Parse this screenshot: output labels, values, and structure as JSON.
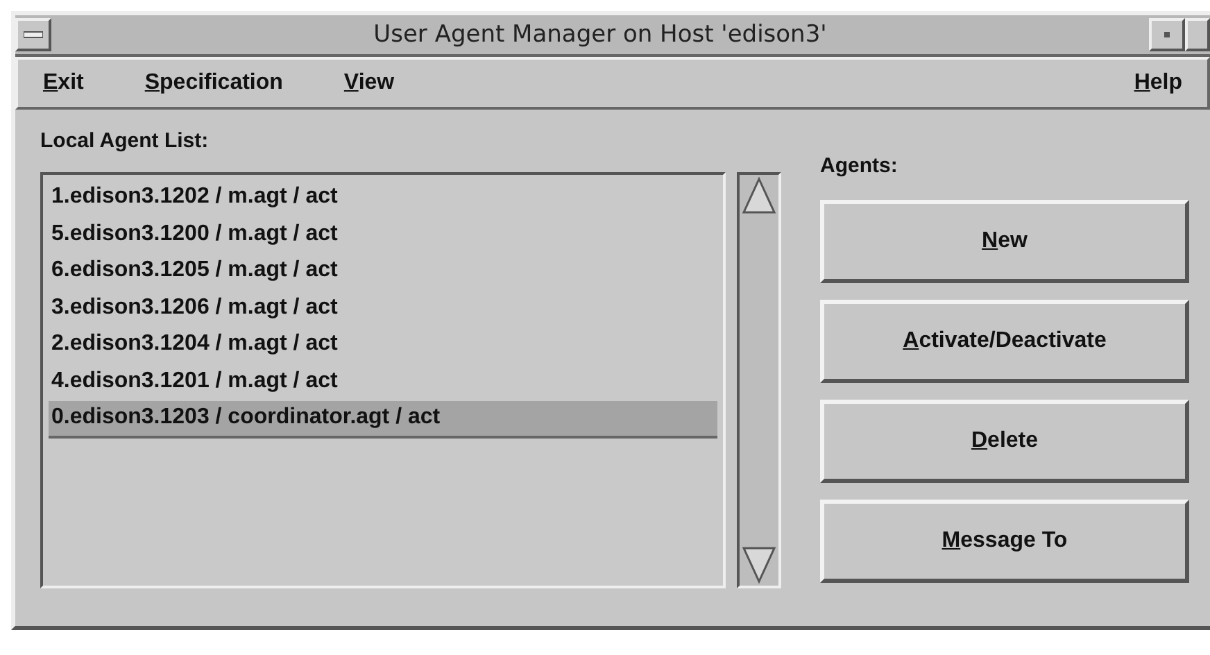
{
  "window": {
    "title": "User Agent Manager on Host 'edison3'"
  },
  "menu": [
    "Exit",
    "Specification",
    "View"
  ],
  "help_menu": "Help",
  "list": {
    "label": "Local Agent List:",
    "items": [
      {
        "text": "1.edison3.1202 / m.agt / act",
        "selected": false
      },
      {
        "text": "5.edison3.1200 / m.agt / act",
        "selected": false
      },
      {
        "text": "6.edison3.1205 / m.agt / act",
        "selected": false
      },
      {
        "text": "3.edison3.1206 / m.agt / act",
        "selected": false
      },
      {
        "text": "2.edison3.1204 / m.agt / act",
        "selected": false
      },
      {
        "text": "4.edison3.1201 / m.agt / act",
        "selected": false
      },
      {
        "text": "0.edison3.1203 / coordinator.agt / act",
        "selected": true
      }
    ]
  },
  "agents": {
    "label": "Agents:",
    "buttons": [
      "New",
      "Activate/Deactivate",
      "Delete",
      "Message To"
    ]
  }
}
